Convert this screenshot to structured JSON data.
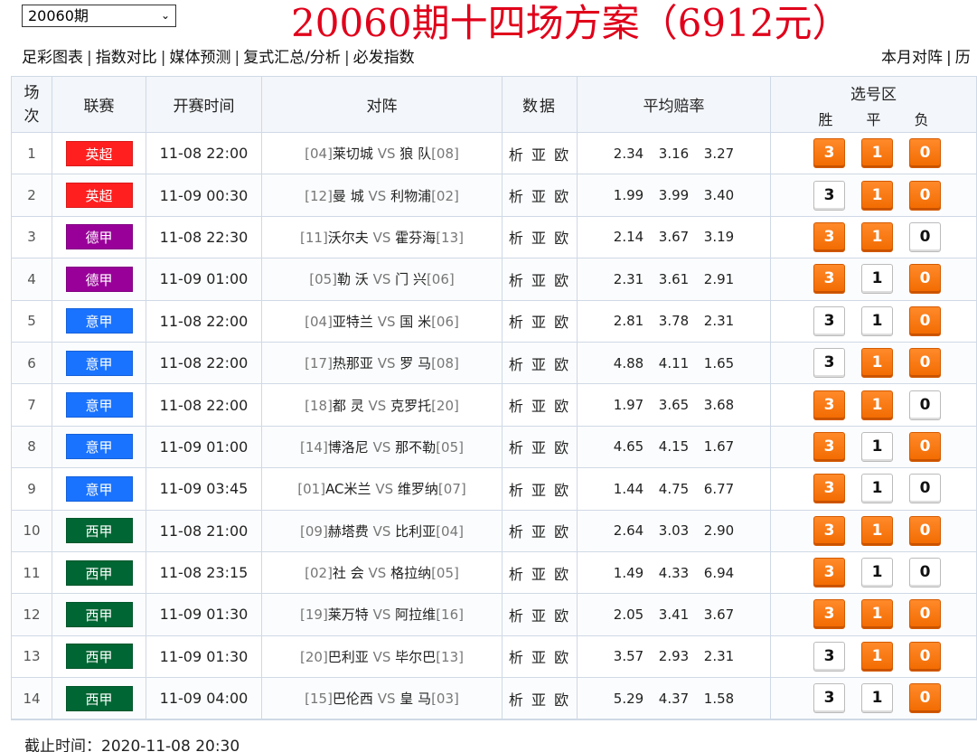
{
  "period_select": {
    "value": "20060期"
  },
  "title": "20060期十四场方案（6912元）",
  "nav_left": [
    "足彩图表",
    "指数对比",
    "媒体预测",
    "复式汇总/分析",
    "必发指数"
  ],
  "nav_right": [
    "本月对阵",
    "历"
  ],
  "headers": {
    "no_line1": "场",
    "no_line2": "次",
    "league": "联赛",
    "time": "开赛时间",
    "match": "对阵",
    "data": "数据",
    "odds": "平均赔率",
    "pick_zone": "选号区",
    "win": "胜",
    "draw": "平",
    "lose": "负"
  },
  "league_colors": {
    "英超": "#ff1f1f",
    "德甲": "#990099",
    "意甲": "#1a73ff",
    "西甲": "#006633"
  },
  "rows": [
    {
      "no": "1",
      "league": "英超",
      "time": "11-08 22:00",
      "home_rank": "[04]",
      "home": "莱切城",
      "vs": "VS",
      "away": "狼 队",
      "away_rank": "[08]",
      "data": "析 亚 欧",
      "odds": [
        "2.34",
        "3.16",
        "3.27"
      ],
      "picks": [
        true,
        true,
        true
      ]
    },
    {
      "no": "2",
      "league": "英超",
      "time": "11-09 00:30",
      "home_rank": "[12]",
      "home": "曼 城",
      "vs": "VS",
      "away": "利物浦",
      "away_rank": "[02]",
      "data": "析 亚 欧",
      "odds": [
        "1.99",
        "3.99",
        "3.40"
      ],
      "picks": [
        false,
        true,
        true
      ]
    },
    {
      "no": "3",
      "league": "德甲",
      "time": "11-08 22:30",
      "home_rank": "[11]",
      "home": "沃尔夫",
      "vs": "VS",
      "away": "霍芬海",
      "away_rank": "[13]",
      "data": "析 亚 欧",
      "odds": [
        "2.14",
        "3.67",
        "3.19"
      ],
      "picks": [
        true,
        true,
        false
      ]
    },
    {
      "no": "4",
      "league": "德甲",
      "time": "11-09 01:00",
      "home_rank": "[05]",
      "home": "勒 沃",
      "vs": "VS",
      "away": "门 兴",
      "away_rank": "[06]",
      "data": "析 亚 欧",
      "odds": [
        "2.31",
        "3.61",
        "2.91"
      ],
      "picks": [
        true,
        false,
        true
      ]
    },
    {
      "no": "5",
      "league": "意甲",
      "time": "11-08 22:00",
      "home_rank": "[04]",
      "home": "亚特兰",
      "vs": "VS",
      "away": "国 米",
      "away_rank": "[06]",
      "data": "析 亚 欧",
      "odds": [
        "2.81",
        "3.78",
        "2.31"
      ],
      "picks": [
        false,
        false,
        true
      ]
    },
    {
      "no": "6",
      "league": "意甲",
      "time": "11-08 22:00",
      "home_rank": "[17]",
      "home": "热那亚",
      "vs": "VS",
      "away": "罗 马",
      "away_rank": "[08]",
      "data": "析 亚 欧",
      "odds": [
        "4.88",
        "4.11",
        "1.65"
      ],
      "picks": [
        false,
        true,
        true
      ]
    },
    {
      "no": "7",
      "league": "意甲",
      "time": "11-08 22:00",
      "home_rank": "[18]",
      "home": "都 灵",
      "vs": "VS",
      "away": "克罗托",
      "away_rank": "[20]",
      "data": "析 亚 欧",
      "odds": [
        "1.97",
        "3.65",
        "3.68"
      ],
      "picks": [
        true,
        true,
        false
      ]
    },
    {
      "no": "8",
      "league": "意甲",
      "time": "11-09 01:00",
      "home_rank": "[14]",
      "home": "博洛尼",
      "vs": "VS",
      "away": "那不勒",
      "away_rank": "[05]",
      "data": "析 亚 欧",
      "odds": [
        "4.65",
        "4.15",
        "1.67"
      ],
      "picks": [
        true,
        false,
        true
      ]
    },
    {
      "no": "9",
      "league": "意甲",
      "time": "11-09 03:45",
      "home_rank": "[01]",
      "home": "AC米兰",
      "vs": "VS",
      "away": "维罗纳",
      "away_rank": "[07]",
      "data": "析 亚 欧",
      "odds": [
        "1.44",
        "4.75",
        "6.77"
      ],
      "picks": [
        true,
        false,
        false
      ]
    },
    {
      "no": "10",
      "league": "西甲",
      "time": "11-08 21:00",
      "home_rank": "[09]",
      "home": "赫塔费",
      "vs": "VS",
      "away": "比利亚",
      "away_rank": "[04]",
      "data": "析 亚 欧",
      "odds": [
        "2.64",
        "3.03",
        "2.90"
      ],
      "picks": [
        true,
        true,
        true
      ]
    },
    {
      "no": "11",
      "league": "西甲",
      "time": "11-08 23:15",
      "home_rank": "[02]",
      "home": "社 会",
      "vs": "VS",
      "away": "格拉纳",
      "away_rank": "[05]",
      "data": "析 亚 欧",
      "odds": [
        "1.49",
        "4.33",
        "6.94"
      ],
      "picks": [
        true,
        false,
        false
      ]
    },
    {
      "no": "12",
      "league": "西甲",
      "time": "11-09 01:30",
      "home_rank": "[19]",
      "home": "莱万特",
      "vs": "VS",
      "away": "阿拉维",
      "away_rank": "[16]",
      "data": "析 亚 欧",
      "odds": [
        "2.05",
        "3.41",
        "3.67"
      ],
      "picks": [
        true,
        true,
        true
      ]
    },
    {
      "no": "13",
      "league": "西甲",
      "time": "11-09 01:30",
      "home_rank": "[20]",
      "home": "巴利亚",
      "vs": "VS",
      "away": "毕尔巴",
      "away_rank": "[13]",
      "data": "析 亚 欧",
      "odds": [
        "3.57",
        "2.93",
        "2.31"
      ],
      "picks": [
        false,
        true,
        true
      ]
    },
    {
      "no": "14",
      "league": "西甲",
      "time": "11-09 04:00",
      "home_rank": "[15]",
      "home": "巴伦西",
      "vs": "VS",
      "away": "皇 马",
      "away_rank": "[03]",
      "data": "析 亚 欧",
      "odds": [
        "5.29",
        "4.37",
        "1.58"
      ],
      "picks": [
        false,
        false,
        true
      ]
    }
  ],
  "pick_labels": [
    "3",
    "1",
    "0"
  ],
  "deadline": "截止时间：2020-11-08 20:30"
}
